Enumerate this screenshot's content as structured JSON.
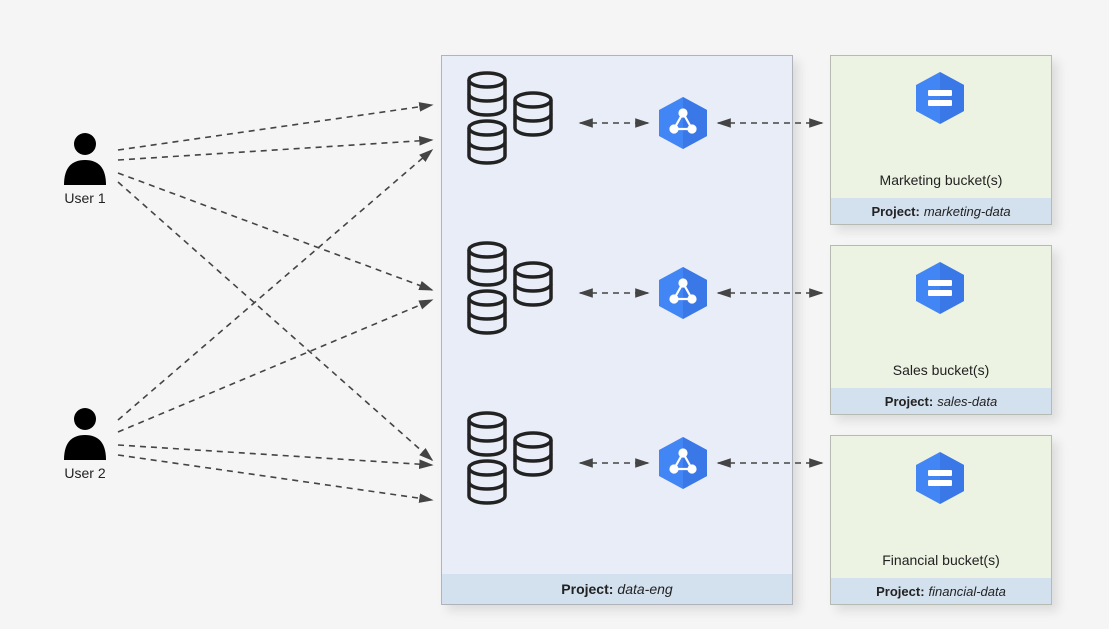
{
  "users": {
    "u1": "User 1",
    "u2": "User 2"
  },
  "project_main": {
    "label_prefix": "Project:",
    "label_name": "data-eng"
  },
  "buckets": {
    "marketing": {
      "title": "Marketing bucket(s)",
      "label_prefix": "Project:",
      "label_name": "marketing-data"
    },
    "sales": {
      "title": "Sales bucket(s)",
      "label_prefix": "Project:",
      "label_name": "sales-data"
    },
    "financial": {
      "title": "Financial bucket(s)",
      "label_prefix": "Project:",
      "label_name": "financial-data"
    }
  }
}
